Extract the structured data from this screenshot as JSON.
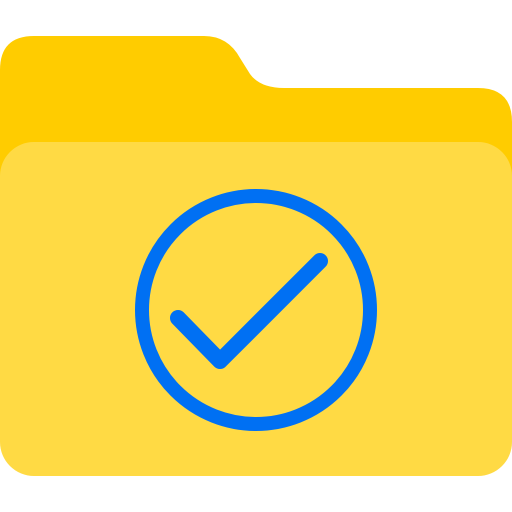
{
  "icon": {
    "name": "folder-check-icon",
    "colors": {
      "folder_back": "#FFCC00",
      "folder_front": "#FFDA44",
      "check": "#0070F3"
    }
  }
}
